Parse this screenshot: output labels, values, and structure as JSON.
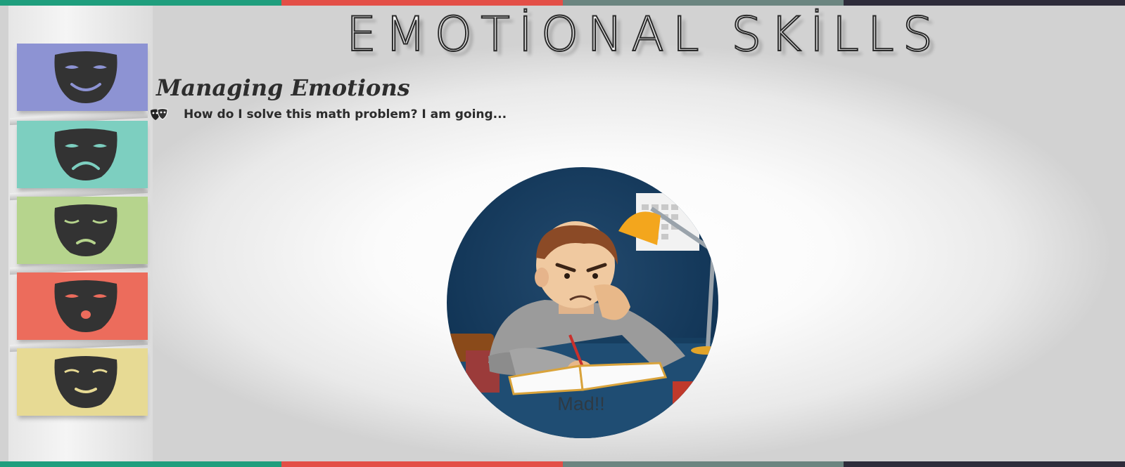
{
  "title": "EMOTİONAL SKİLLS",
  "section": {
    "heading": "Managing Emotions",
    "question": "How do I solve this math problem? I am going..."
  },
  "illustration": {
    "caption": "Mad!!",
    "subject": "angry-boy-studying"
  },
  "sidebar": {
    "panels": [
      {
        "emotion": "happy",
        "color": "#8d93d3",
        "icon": "happy-mask-icon"
      },
      {
        "emotion": "sad",
        "color": "#7dcfc0",
        "icon": "sad-mask-icon"
      },
      {
        "emotion": "disappointed",
        "color": "#b6d48d",
        "icon": "disappointed-mask-icon"
      },
      {
        "emotion": "surprised",
        "color": "#ec6c5c",
        "icon": "surprised-mask-icon"
      },
      {
        "emotion": "content",
        "color": "#e7da94",
        "icon": "content-mask-icon"
      }
    ]
  },
  "colors": {
    "stripe": [
      "#1f9e7d",
      "#e34f47",
      "#6b8580",
      "#2e2c3a"
    ]
  }
}
